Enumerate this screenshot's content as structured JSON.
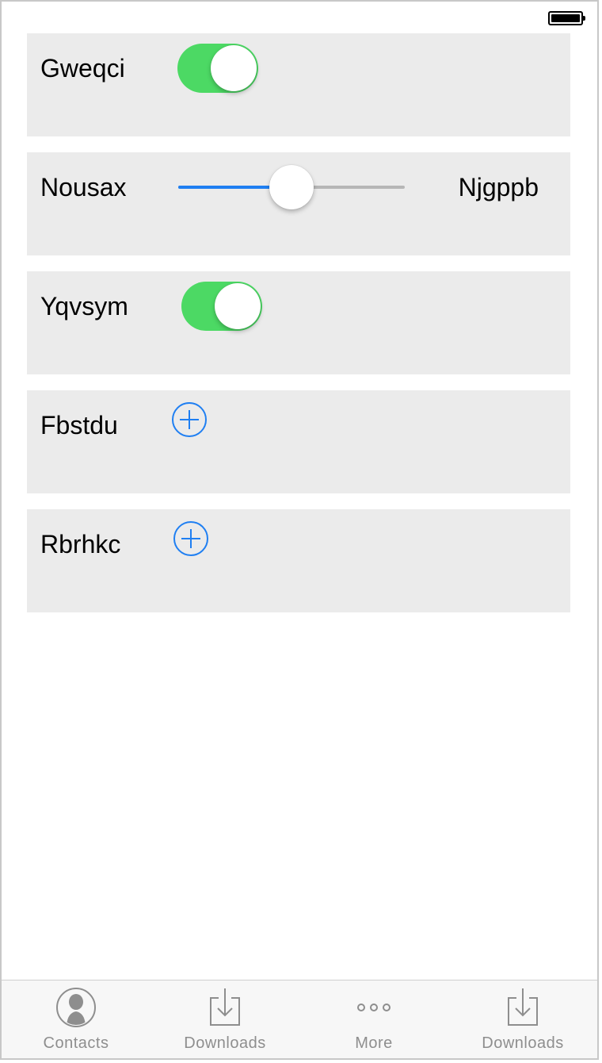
{
  "status_bar": {
    "battery_icon": "battery-full-icon"
  },
  "rows": [
    {
      "label": "Gweqci",
      "control": "switch",
      "on": true
    },
    {
      "label": "Nousax",
      "control": "slider",
      "value_fraction": 0.5,
      "right_label": "Njgppb"
    },
    {
      "label": "Yqvsym",
      "control": "switch",
      "on": true
    },
    {
      "label": "Fbstdu",
      "control": "add-button",
      "icon": "plus-circle-icon"
    },
    {
      "label": "Rbrhkc",
      "control": "add-button",
      "icon": "plus-circle-icon"
    }
  ],
  "tabbar": {
    "tabs": [
      {
        "label": "Contacts",
        "icon": "contact-avatar-icon"
      },
      {
        "label": "Downloads",
        "icon": "download-icon"
      },
      {
        "label": "More",
        "icon": "more-dots-icon"
      },
      {
        "label": "Downloads",
        "icon": "download-icon"
      }
    ]
  },
  "colors": {
    "switch_on": "#4cd964",
    "accent_blue": "#1f7ff2",
    "card_bg": "#ebebeb",
    "tab_label": "#8e8e8e"
  }
}
